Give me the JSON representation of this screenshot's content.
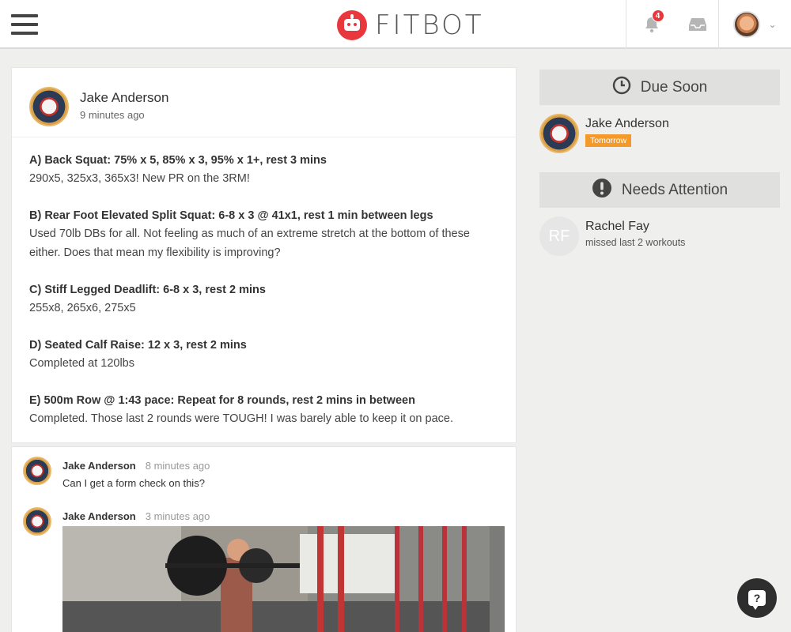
{
  "header": {
    "brand": "FITBOT",
    "notification_count": "4"
  },
  "post": {
    "author": "Jake Anderson",
    "time": "9 minutes ago",
    "sections": [
      {
        "title": "A) Back Squat: 75% x 5, 85% x 3, 95% x 1+, rest 3 mins",
        "text": "290x5, 325x3, 365x3! New PR on the 3RM!"
      },
      {
        "title": "B) Rear Foot Elevated Split Squat: 6-8 x 3 @ 41x1, rest 1 min between legs",
        "text": "Used 70lb DBs for all. Not feeling as much of an extreme stretch at the bottom of these either. Does that mean my flexibility is improving?"
      },
      {
        "title": "C) Stiff Legged Deadlift: 6-8 x 3, rest 2 mins",
        "text": "255x8, 265x6, 275x5"
      },
      {
        "title": "D) Seated Calf Raise: 12 x 3, rest 2 mins",
        "text": "Completed at 120lbs"
      },
      {
        "title": "E) 500m Row @ 1:43 pace: Repeat for 8 rounds, rest 2 mins in between",
        "text": "Completed. Those last 2 rounds were TOUGH! I was barely able to keep it on pace."
      }
    ]
  },
  "comments": [
    {
      "author": "Jake Anderson",
      "time": "8 minutes ago",
      "text": "Can I get a form check on this?"
    },
    {
      "author": "Jake Anderson",
      "time": "3 minutes ago",
      "text": ""
    }
  ],
  "sidebar": {
    "due_soon": {
      "title": "Due Soon",
      "person": "Jake Anderson",
      "tag": "Tomorrow"
    },
    "needs_attention": {
      "title": "Needs Attention",
      "initials": "RF",
      "person": "Rachel Fay",
      "note": "missed last 2 workouts"
    }
  },
  "help_label": "?"
}
